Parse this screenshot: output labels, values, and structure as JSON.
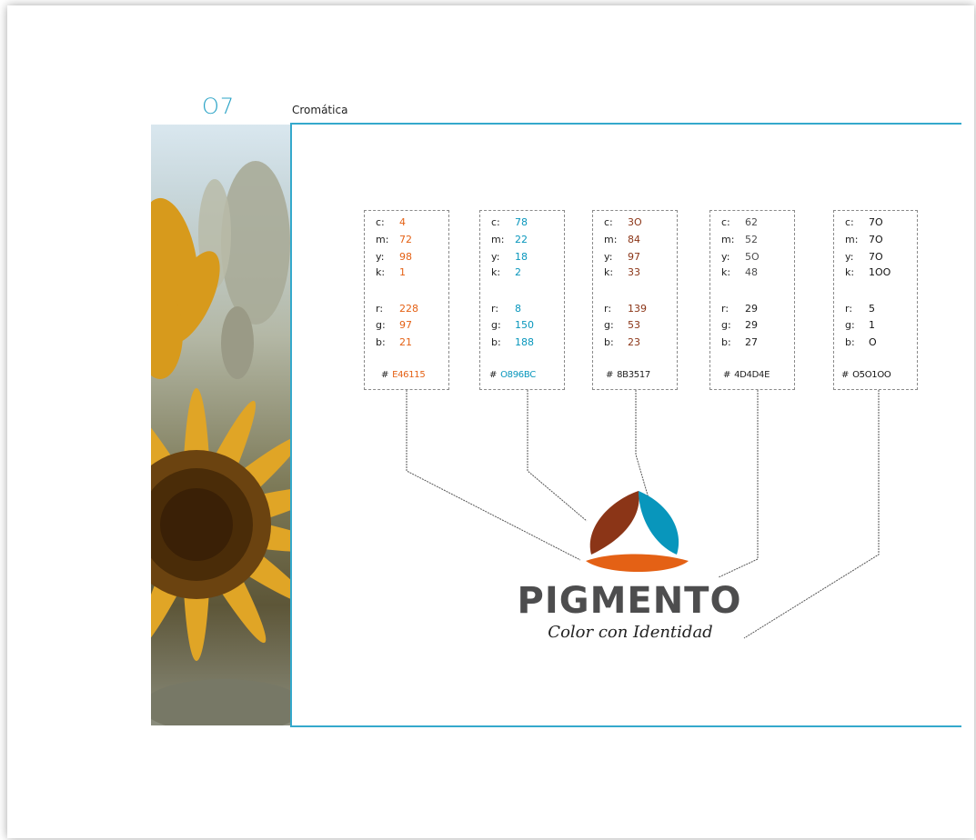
{
  "section": {
    "number": "O7",
    "title": "Cromática"
  },
  "swatches": [
    {
      "accent": "#e46115",
      "cmyk": [
        [
          "c:",
          "4"
        ],
        [
          "m:",
          "72"
        ],
        [
          "y:",
          "98"
        ],
        [
          "k:",
          "1"
        ]
      ],
      "rgb": [
        [
          "r:",
          "228"
        ],
        [
          "g:",
          "97"
        ],
        [
          "b:",
          "21"
        ]
      ],
      "hex": "E46115"
    },
    {
      "accent": "#0896bc",
      "cmyk": [
        [
          "c:",
          "78"
        ],
        [
          "m:",
          "22"
        ],
        [
          "y:",
          "18"
        ],
        [
          "k:",
          "2"
        ]
      ],
      "rgb": [
        [
          "r:",
          "8"
        ],
        [
          "g:",
          "150"
        ],
        [
          "b:",
          "188"
        ]
      ],
      "hex": "O896BC"
    },
    {
      "accent": "#8b3517",
      "cmyk": [
        [
          "c:",
          "3O"
        ],
        [
          "m:",
          "84"
        ],
        [
          "y:",
          "97"
        ],
        [
          "k:",
          "33"
        ]
      ],
      "rgb": [
        [
          "r:",
          "139"
        ],
        [
          "g:",
          "53"
        ],
        [
          "b:",
          "23"
        ]
      ],
      "hex": "8B3517"
    },
    {
      "accent": "#4d4d4e",
      "cmyk": [
        [
          "c:",
          "62"
        ],
        [
          "m:",
          "52"
        ],
        [
          "y:",
          "5O"
        ],
        [
          "k:",
          "48"
        ]
      ],
      "rgb": [
        [
          "r:",
          "29"
        ],
        [
          "g:",
          "29"
        ],
        [
          "b:",
          "27"
        ]
      ],
      "hex": "4D4D4E"
    },
    {
      "accent": "#050100",
      "cmyk": [
        [
          "c:",
          "7O"
        ],
        [
          "m:",
          "7O"
        ],
        [
          "y:",
          "7O"
        ],
        [
          "k:",
          "1OO"
        ]
      ],
      "rgb": [
        [
          "r:",
          "5"
        ],
        [
          "g:",
          "1"
        ],
        [
          "b:",
          "O"
        ]
      ],
      "hex": "O5O1OO"
    }
  ],
  "logo": {
    "wordmark": "PIGMENTO",
    "tagline": "Color con Identidad"
  }
}
